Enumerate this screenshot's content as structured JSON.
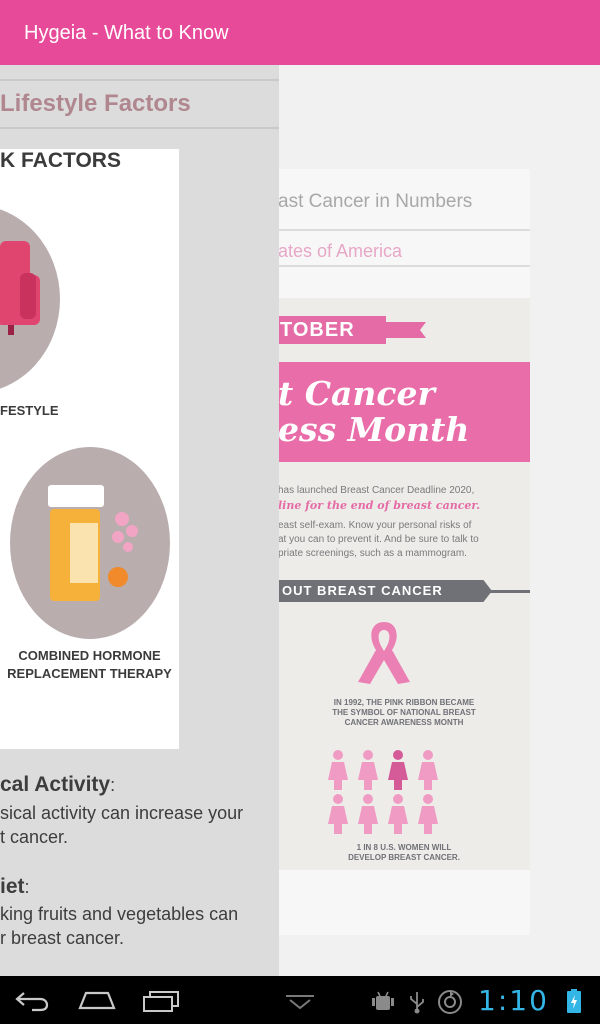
{
  "app": {
    "title": "Hygeia - What to Know"
  },
  "background_page": {
    "title": "ast Cancer in Numbers",
    "subtitle": "ates of America",
    "infographic": {
      "month_tag": "TOBER",
      "banner_line1": "t Cancer",
      "banner_line2": "ess Month",
      "deadline_line": "has launched Breast Cancer Deadline 2020,",
      "deadline_tagline": "line for the end of breast cancer.",
      "advice_lines": [
        "east self-exam. Know your personal risks of",
        "at you can to prevent it. And be sure to talk to",
        "priate screenings, such as a mammogram."
      ],
      "about_label": "OUT BREAST CANCER",
      "ribbon_caption": [
        "IN 1992, THE PINK RIBBON BECAME",
        "THE SYMBOL OF NATIONAL BREAST",
        "CANCER AWARENESS MONTH"
      ],
      "women_caption": [
        "1 IN 8 U.S. WOMEN WILL",
        "DEVELOP BREAST CANCER."
      ]
    }
  },
  "drawer": {
    "header": "Lifestyle Factors",
    "card": {
      "title": "K FACTORS",
      "lifestyle_label": "FESTYLE",
      "hrt_label_line1": "COMBINED HORMONE",
      "hrt_label_line2": "REPLACEMENT THERAPY"
    },
    "physical": {
      "heading": "cal Activity",
      "colon": ":",
      "line1": "sical activity can increase your",
      "line2": "t cancer."
    },
    "diet": {
      "heading": "iet",
      "colon": ":",
      "line1": "king fruits and vegetables can",
      "line2": "r breast cancer."
    }
  },
  "status": {
    "time": "1:10"
  },
  "colors": {
    "accent": "#e84a9a",
    "clock": "#33b5e5"
  },
  "icons": [
    "back-icon",
    "home-icon",
    "recent-apps-icon",
    "collapse-icon",
    "android-debug-icon",
    "usb-icon",
    "sync-icon",
    "battery-icon"
  ]
}
